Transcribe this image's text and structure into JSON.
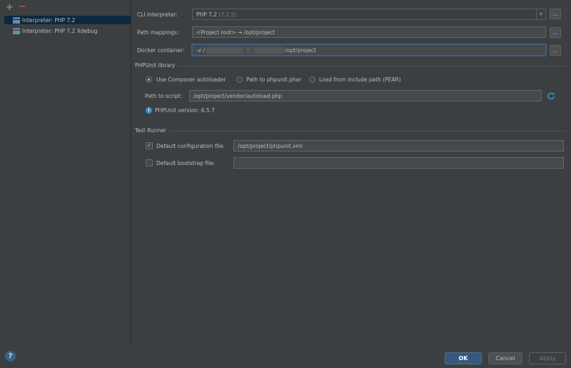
{
  "toolbar": {
    "add_symbol": "+",
    "remove_symbol": "−"
  },
  "interpreters": [
    {
      "label": "Interpreter: PHP 7.2",
      "selected": true
    },
    {
      "label": "Interpreter: PHP 7.2 Xdebug",
      "selected": false
    }
  ],
  "cli_interpreter": {
    "label": "CLI Interpreter:",
    "value": "PHP 7.2",
    "version": "(7.2.5)",
    "browse": "..."
  },
  "path_mappings": {
    "label": "Path mappings:",
    "value": "<Project root> → /opt/project",
    "browse": "..."
  },
  "docker_container": {
    "label": "Docker container:",
    "value_prefix": "-v /",
    "value_suffix": ":/opt/project",
    "browse": "..."
  },
  "phpunit_library": {
    "title": "PHPUnit library",
    "options": [
      {
        "label": "Use Composer autoloader",
        "checked": true
      },
      {
        "label": "Path to phpunit.phar",
        "checked": false
      },
      {
        "label": "Load from include path (PEAR)",
        "checked": false
      }
    ],
    "path_label": "Path to script:",
    "path_value": "/opt/project/vendor/autoload.php",
    "info_icon": "i",
    "version_text": "PHPUnit version: 6.5.7"
  },
  "test_runner": {
    "title": "Test Runner",
    "config_label": "Default configuration file:",
    "config_checked": true,
    "config_value": "/opt/project/phpunit.xml",
    "bootstrap_label": "Default bootstrap file:",
    "bootstrap_checked": false,
    "bootstrap_value": ""
  },
  "buttons": {
    "help": "?",
    "ok": "OK",
    "cancel": "Cancel",
    "apply": "Apply"
  },
  "icons": {
    "add": "plus-icon",
    "remove": "minus-icon",
    "interpreter": "php-interpreter-icon",
    "refresh": "refresh-icon",
    "info": "info-icon",
    "combo_arrow": "chevron-down-icon"
  }
}
